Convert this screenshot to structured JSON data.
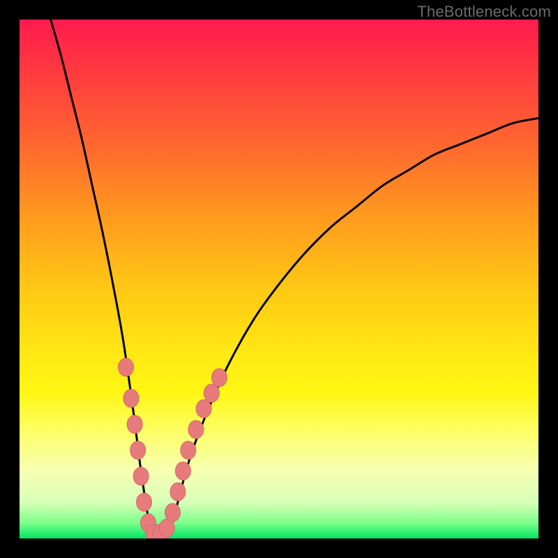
{
  "watermark": "TheBottleneck.com",
  "colors": {
    "frame": "#000000",
    "curve": "#000000",
    "marker_fill": "#e77a7a",
    "marker_stroke": "#d46a6a"
  },
  "chart_data": {
    "type": "line",
    "title": "",
    "xlabel": "",
    "ylabel": "",
    "xlim": [
      0,
      100
    ],
    "ylim": [
      0,
      100
    ],
    "series": [
      {
        "name": "bottleneck-curve",
        "x": [
          6,
          8,
          10,
          12,
          14,
          16,
          18,
          20,
          22,
          23,
          24,
          25,
          26,
          27,
          28,
          29,
          30,
          31,
          33,
          36,
          40,
          45,
          50,
          55,
          60,
          65,
          70,
          75,
          80,
          85,
          90,
          95,
          100
        ],
        "y": [
          100,
          93,
          85,
          77,
          68,
          59,
          49,
          38,
          24,
          16,
          9,
          3,
          0,
          0,
          0,
          2,
          5,
          9,
          16,
          24,
          33,
          42,
          49,
          55,
          60,
          64,
          68,
          71,
          74,
          76,
          78,
          80,
          81
        ]
      }
    ],
    "markers": {
      "name": "highlighted-points",
      "points": [
        {
          "x": 20.5,
          "y": 33
        },
        {
          "x": 21.5,
          "y": 27
        },
        {
          "x": 22.2,
          "y": 22
        },
        {
          "x": 22.8,
          "y": 17
        },
        {
          "x": 23.4,
          "y": 12
        },
        {
          "x": 24.0,
          "y": 7
        },
        {
          "x": 24.8,
          "y": 3
        },
        {
          "x": 25.8,
          "y": 1
        },
        {
          "x": 27.2,
          "y": 1
        },
        {
          "x": 28.4,
          "y": 2
        },
        {
          "x": 29.5,
          "y": 5
        },
        {
          "x": 30.5,
          "y": 9
        },
        {
          "x": 31.5,
          "y": 13
        },
        {
          "x": 32.5,
          "y": 17
        },
        {
          "x": 34.0,
          "y": 21
        },
        {
          "x": 35.5,
          "y": 25
        },
        {
          "x": 37.0,
          "y": 28
        },
        {
          "x": 38.5,
          "y": 31
        }
      ]
    }
  }
}
